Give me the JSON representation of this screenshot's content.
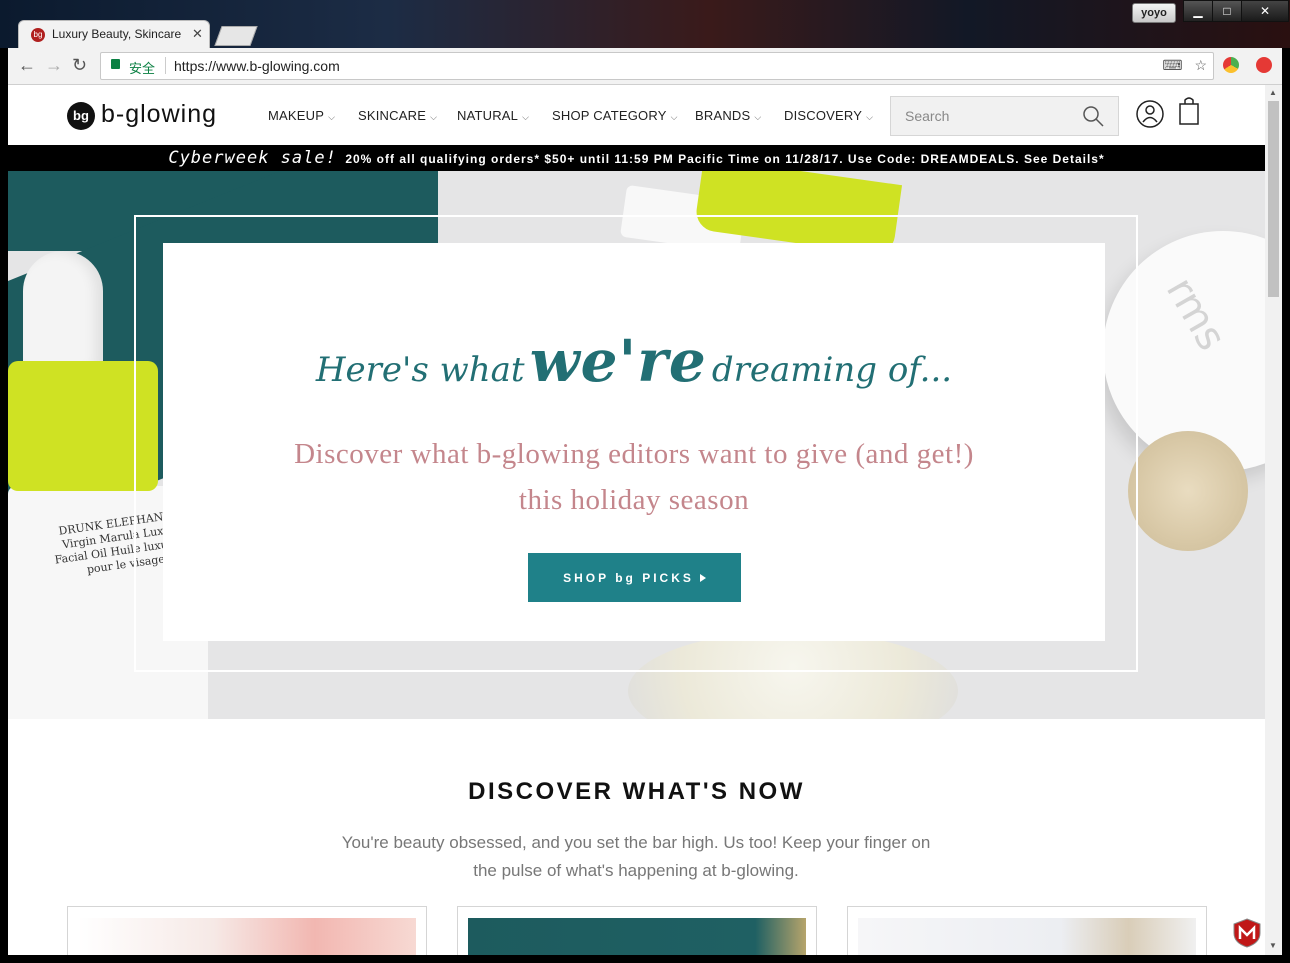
{
  "browser": {
    "tab_title": "Luxury Beauty, Skincare",
    "profile_name": "yoyo",
    "secure_label": "安全",
    "url": "https://www.b-glowing.com"
  },
  "header": {
    "logo_mark": "bg",
    "logo_text": "b-glowing",
    "nav": [
      "MAKEUP",
      "SKINCARE",
      "NATURAL",
      "SHOP CATEGORY",
      "BRANDS",
      "DISCOVERY"
    ],
    "search_placeholder": "Search"
  },
  "promo": {
    "sale_label": "Cyberweek sale!",
    "text": "20% off all qualifying orders* $50+ until 11:59 PM Pacific Time on 11/28/17. Use Code: DREAMDEALS. See Details*"
  },
  "hero": {
    "script_part1": "Here's what",
    "script_part2": "we're",
    "script_part3": "dreaming of...",
    "subtitle_line1": "Discover what b-glowing editors want to give (and get!)",
    "subtitle_line2": "this holiday season",
    "button_label": "SHOP bg PICKS",
    "bottle_label": "DRUNK ELEPHANT™ Virgin Marula Luxury Facial Oil Huile luxueuse pour le visage"
  },
  "discover": {
    "title": "DISCOVER WHAT'S NOW",
    "subtitle": "You're beauty obsessed, and you set the bar high. Us too! Keep your finger on the pulse of what's happening at b-glowing."
  },
  "colors": {
    "teal_accent": "#1f8189",
    "script_teal": "#226f74",
    "rose_text": "#c4868c",
    "promo_bg": "#000000"
  }
}
